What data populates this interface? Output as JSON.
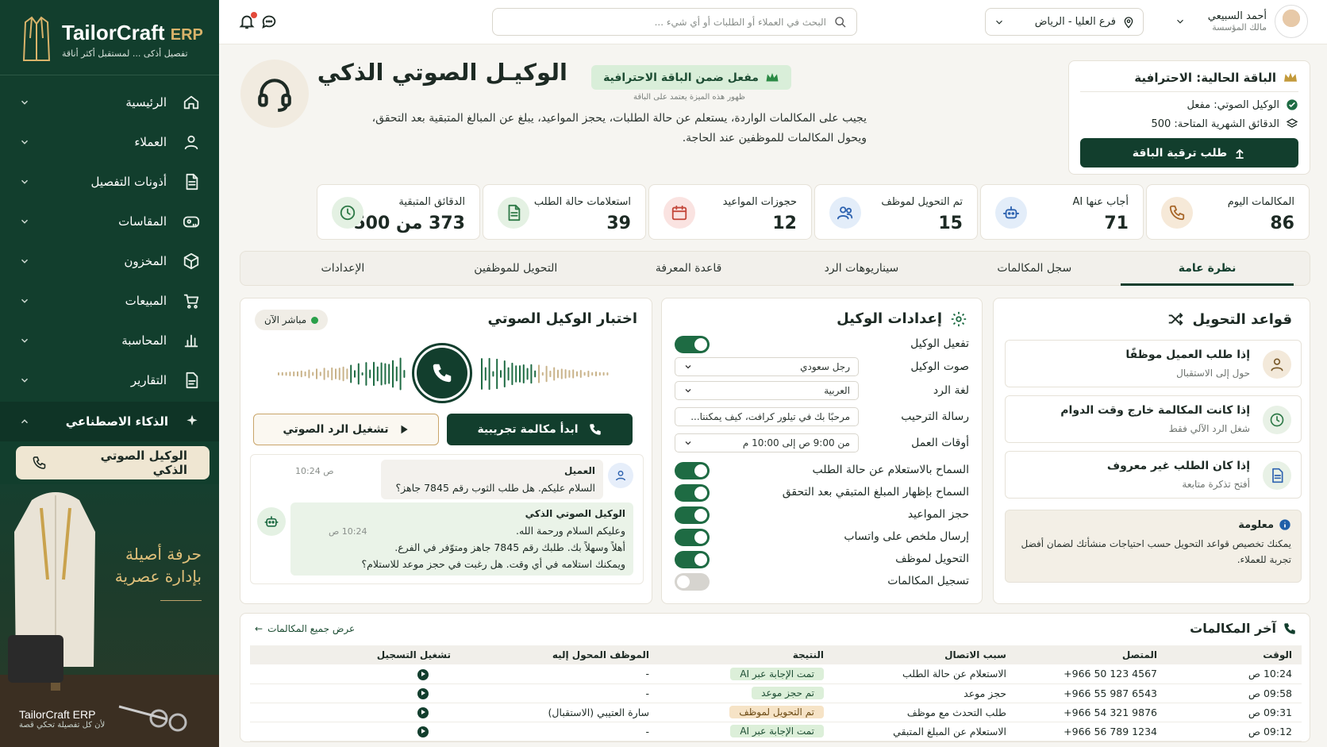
{
  "sidebar": {
    "brand": "TailorCraft",
    "brand_suffix": "ERP",
    "tagline": "تفصيل أذكى ... لمستقبل أكثر أناقة",
    "items": [
      {
        "label": "الرئيسية",
        "icon": "home-icon"
      },
      {
        "label": "العملاء",
        "icon": "user-icon"
      },
      {
        "label": "أذونات التفصيل",
        "icon": "document-icon"
      },
      {
        "label": "المقاسات",
        "icon": "measuring-tape-icon"
      },
      {
        "label": "المخزون",
        "icon": "box-icon"
      },
      {
        "label": "المبيعات",
        "icon": "cart-icon"
      },
      {
        "label": "المحاسبة",
        "icon": "bar-chart-icon"
      },
      {
        "label": "التقارير",
        "icon": "report-icon"
      }
    ],
    "ai_section": "الذكاء الاصطناعي",
    "ai_sub": "الوكيل الصوتي الذكي",
    "promo_line1": "حرفة أصيلة",
    "promo_line2": "بإدارة عصرية",
    "footer_title": "TailorCraft ERP",
    "footer_sub": "لأن كل تفصيلة تحكي قصة"
  },
  "topbar": {
    "search_placeholder": "البحث في العملاء أو الطلبات أو أي شيء ...",
    "branch": "فرع العليا - الرياض",
    "user_name": "أحمد السبيعي",
    "user_role": "مالك المؤسسة"
  },
  "header": {
    "title": "الوكيـل الصوتي الذكي",
    "badge": "مفعل ضمن الباقة الاحترافية",
    "badge_note": "ظهور هذه الميزة يعتمد على الباقة",
    "desc_line1": "يجيب على المكالمات الواردة، يستعلم عن حالة الطلبات، يحجز المواعيد، يبلغ عن المبالغ المتبقية بعد التحقق،",
    "desc_line2": "ويحول المكالمات للموظفين عند الحاجة."
  },
  "plan": {
    "title": "الباقة الحالية: الاحترافية",
    "row1": "الوكيل الصوتي: مفعل",
    "row2": "الدقائق الشهرية المتاحة: 500",
    "button": "طلب ترقية الباقة"
  },
  "kpis": [
    {
      "label": "المكالمات اليوم",
      "value": "86",
      "icon": "phone-icon",
      "bg": "#f6e9d8",
      "color": "#a8672a"
    },
    {
      "label": "أجاب عنها AI",
      "value": "71",
      "icon": "robot-icon",
      "bg": "#e3edf9",
      "color": "#2e63b0"
    },
    {
      "label": "تم التحويل لموظف",
      "value": "15",
      "icon": "users-icon",
      "bg": "#e3edf9",
      "color": "#2e63b0"
    },
    {
      "label": "حجوزات المواعيد",
      "value": "12",
      "icon": "calendar-icon",
      "bg": "#fae3e1",
      "color": "#c4483c"
    },
    {
      "label": "استعلامات حالة الطلب",
      "value": "39",
      "icon": "document-icon",
      "bg": "#e4f1e3",
      "color": "#2f7a48"
    },
    {
      "label": "الدقائق المتبقية",
      "value": "373 من 500",
      "icon": "clock-icon",
      "bg": "#e4f1e3",
      "color": "#2f7a48"
    }
  ],
  "tabs": [
    "نظرة عامة",
    "سجل المكالمات",
    "سيناريوهات الرد",
    "قاعدة المعرفة",
    "التحويل للموظفين",
    "الإعدادات"
  ],
  "rules": {
    "title": "قواعد التحويل",
    "items": [
      {
        "title": "إذا طلب العميل موظفًا",
        "sub": "حول إلى الاستقبال",
        "icon": "person-icon"
      },
      {
        "title": "إذا كانت المكالمة خارج وقت الدوام",
        "sub": "شغل الرد الآلي فقط",
        "icon": "clock-icon"
      },
      {
        "title": "إذا كان الطلب غير معروف",
        "sub": "أفتح تذكرة متابعة",
        "icon": "ticket-icon"
      }
    ],
    "info_title": "معلومة",
    "info_text": "يمكنك تخصيص قواعد التحويل حسب احتياجات منشأتك لضمان أفضل تجربة للعملاء."
  },
  "settings": {
    "title": "إعدادات الوكيل",
    "enable": "تفعيل الوكيل",
    "voice_label": "صوت الوكيل",
    "voice_value": "رجل سعودي",
    "lang_label": "لغة الرد",
    "lang_value": "العربية",
    "welcome_label": "رسالة الترحيب",
    "welcome_value": "مرحبًا بك في تيلور كرافت، كيف يمكننا...",
    "hours_label": "أوقات العمل",
    "hours_value": "من 9:00 ص إلى 10:00 م",
    "toggles": [
      {
        "label": "السماح بالاستعلام عن حالة الطلب",
        "on": true
      },
      {
        "label": "السماح بإظهار المبلغ المتبقي بعد التحقق",
        "on": true
      },
      {
        "label": "حجز المواعيد",
        "on": true
      },
      {
        "label": "إرسال ملخص على واتساب",
        "on": true
      },
      {
        "label": "التحويل لموظف",
        "on": true
      },
      {
        "label": "تسجيل المكالمات",
        "on": false
      }
    ]
  },
  "test": {
    "title": "اختبار الوكيل الصوتي",
    "live": "مباشر الآن",
    "start": "ابدأ مكالمة تجريبية",
    "play": "تشغيل الرد الصوتي",
    "customer_name": "العميل",
    "customer_msg": "السلام عليكم. هل طلب الثوب رقم 7845 جاهز؟",
    "customer_time": "10:24 ص",
    "agent_name": "الوكيل الصوتي الذكي",
    "agent_time": "10:24 ص",
    "agent_l1": "وعليكم السلام ورحمة الله.",
    "agent_l2": "أهلاً وسهلاً بك. طلبك رقم 7845 جاهز ومتوّفر في الفرع.",
    "agent_l3": "ويمكنك استلامه في أي وقت. هل رغبت في حجز موعد للاستلام؟"
  },
  "calls": {
    "title": "آخر المكالمات",
    "view_all": "عرض جميع المكالمات",
    "headers": [
      "الوقت",
      "المتصل",
      "سبب الاتصال",
      "النتيجة",
      "الموظف المحول إليه",
      "تشغيل التسجيل"
    ],
    "rows": [
      {
        "time": "10:24 ص",
        "caller": "+966 50 123 4567",
        "reason": "الاستعلام عن حالة الطلب",
        "result": "تمت الإجابة عبر AI",
        "kind": "g",
        "staff": "-"
      },
      {
        "time": "09:58 ص",
        "caller": "+966 55 987 6543",
        "reason": "حجز موعد",
        "result": "تم حجز موعد",
        "kind": "g",
        "staff": "-"
      },
      {
        "time": "09:31 ص",
        "caller": "+966 54 321 9876",
        "reason": "طلب التحدث مع موظف",
        "result": "تم التحويل لموظف",
        "kind": "y",
        "staff": "سارة العتيبي (الاستقبال)"
      },
      {
        "time": "09:12 ص",
        "caller": "+966 56 789 1234",
        "reason": "الاستعلام عن المبلغ المتبقي",
        "result": "تمت الإجابة عبر AI",
        "kind": "g",
        "staff": "-"
      }
    ]
  }
}
